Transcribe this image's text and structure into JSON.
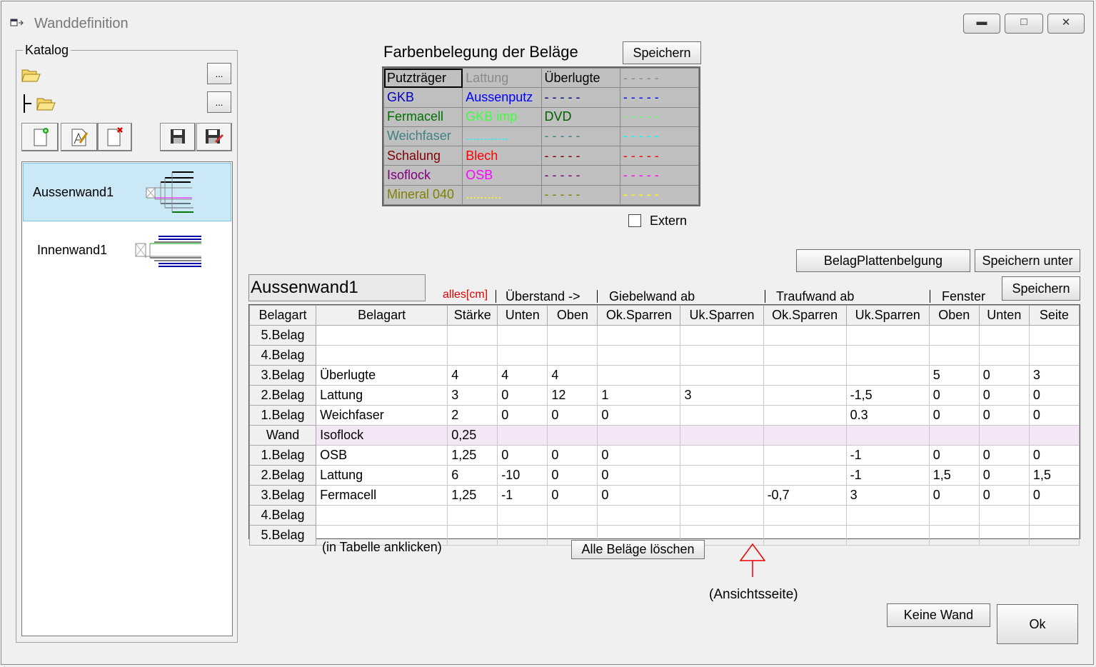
{
  "window": {
    "title": "Wanddefinition"
  },
  "katalog": {
    "label": "Katalog",
    "browse_label": "...",
    "items": [
      {
        "name": "Aussenwand1"
      },
      {
        "name": "Innenwand1"
      }
    ]
  },
  "colors": {
    "title": "Farbenbelegung der Beläge",
    "save_label": "Speichern",
    "rows": [
      [
        {
          "text": "Putzträger",
          "color": "#000000"
        },
        {
          "text": "Lattung",
          "color": "#8a8a8a"
        },
        {
          "text": "Überlugte",
          "color": "#000000"
        },
        {
          "text": "- - - - -",
          "color": "#8a8a8a"
        }
      ],
      [
        {
          "text": "GKB",
          "color": "#0000c0"
        },
        {
          "text": "Aussenputz",
          "color": "#0000ff"
        },
        {
          "text": "- - - - -",
          "color": "#000080"
        },
        {
          "text": "- - - - -",
          "color": "#0000ff"
        }
      ],
      [
        {
          "text": "Fermacell",
          "color": "#007000"
        },
        {
          "text": "GKB imp",
          "color": "#40ff40"
        },
        {
          "text": "DVD",
          "color": "#006000"
        },
        {
          "text": "- - - - -",
          "color": "#60ff60"
        }
      ],
      [
        {
          "text": "Weichfaser",
          "color": "#408080"
        },
        {
          "text": "............",
          "color": "#00ffff"
        },
        {
          "text": "- - - - -",
          "color": "#408080"
        },
        {
          "text": "- - - - -",
          "color": "#00ffff"
        }
      ],
      [
        {
          "text": "Schalung",
          "color": "#800000"
        },
        {
          "text": "Blech",
          "color": "#ff0000"
        },
        {
          "text": "- - - - -",
          "color": "#800000"
        },
        {
          "text": "- - - - -",
          "color": "#ff0000"
        }
      ],
      [
        {
          "text": "Isoflock",
          "color": "#800080"
        },
        {
          "text": "OSB",
          "color": "#ff00ff"
        },
        {
          "text": "- - - - -",
          "color": "#800080"
        },
        {
          "text": "- - - - -",
          "color": "#ff00ff"
        }
      ],
      [
        {
          "text": "Mineral 040",
          "color": "#808000"
        },
        {
          "text": "..........",
          "color": "#ffff00"
        },
        {
          "text": "- - - - -",
          "color": "#808000"
        },
        {
          "text": "- - - - -",
          "color": "#ffff00"
        }
      ]
    ],
    "extern_label": "Extern",
    "extern_checked": false
  },
  "buttons": {
    "belag_platten": "BelagPlattenbelgung",
    "save_as": "Speichern unter",
    "save": "Speichern",
    "clear_all": "Alle Beläge löschen",
    "keine_wand": "Keine Wand",
    "ok": "Ok"
  },
  "wall": {
    "name": "Aussenwand1",
    "alles": "alles[cm]",
    "group_headers": {
      "ueberstand": "Überstand  ->",
      "giebelwand": "Giebelwand ab",
      "traufwand": "Traufwand ab",
      "fenster": "Fenster"
    },
    "columns": [
      "Belagart",
      "Belagart",
      "Stärke",
      "Unten",
      "Oben",
      "Ok.Sparren",
      "Uk.Sparren",
      "Ok.Sparren",
      "Uk.Sparren",
      "Oben",
      "Unten",
      "Seite"
    ],
    "rows": [
      [
        "5.Belag",
        "",
        "",
        "",
        "",
        "",
        "",
        "",
        "",
        "",
        "",
        ""
      ],
      [
        "4.Belag",
        "",
        "",
        "",
        "",
        "",
        "",
        "",
        "",
        "",
        "",
        ""
      ],
      [
        "3.Belag",
        "Überlugte",
        "4",
        "4",
        "4",
        "",
        "",
        "",
        "",
        "5",
        "0",
        "3"
      ],
      [
        "2.Belag",
        "Lattung",
        "3",
        "0",
        "12",
        "1",
        "3",
        "",
        "-1,5",
        "0",
        "0",
        "0"
      ],
      [
        "1.Belag",
        "Weichfaser",
        "2",
        "0",
        "0",
        "0",
        "",
        "",
        "0.3",
        "0",
        "0",
        "0"
      ],
      [
        "Wand",
        "Isoflock",
        "0,25",
        "",
        "",
        "",
        "",
        "",
        "",
        "",
        "",
        ""
      ],
      [
        "1.Belag",
        "OSB",
        "1,25",
        "0",
        "0",
        "0",
        "",
        "",
        "-1",
        "0",
        "0",
        "0"
      ],
      [
        "2.Belag",
        "Lattung",
        "6",
        "-10",
        "0",
        "0",
        "",
        "",
        "-1",
        "1,5",
        "0",
        "1,5"
      ],
      [
        "3.Belag",
        "Fermacell",
        "1,25",
        "-1",
        "0",
        "0",
        "",
        "-0,7",
        "3",
        "0",
        "0",
        "0"
      ],
      [
        "4.Belag",
        "",
        "",
        "",
        "",
        "",
        "",
        "",
        "",
        "",
        "",
        ""
      ],
      [
        "5.Belag",
        "",
        "",
        "",
        "",
        "",
        "",
        "",
        "",
        "",
        "",
        ""
      ]
    ],
    "hint": "(in Tabelle anklicken)",
    "ansicht": "(Ansichtsseite)"
  }
}
